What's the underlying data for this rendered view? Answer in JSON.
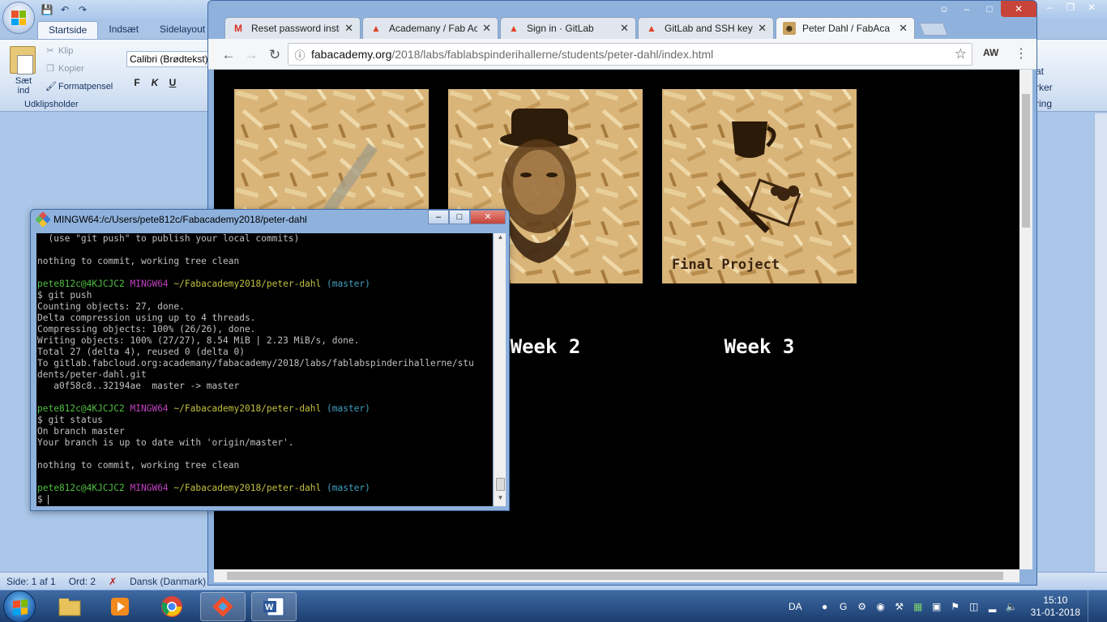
{
  "word": {
    "tabs": [
      "Startside",
      "Indsæt",
      "Sidelayout"
    ],
    "clipboard": {
      "paste_label": "Sæt ind",
      "cut": "Klip",
      "copy": "Kopier",
      "format_painter": "Formatpensel",
      "group_label": "Udklipsholder"
    },
    "font_name": "Calibri (Brødtekst)",
    "format_buttons": [
      "F",
      "K",
      "U"
    ],
    "right_fragments": [
      "at",
      "rker",
      "ring"
    ],
    "status": {
      "page": "Side: 1 af 1",
      "words": "Ord: 2",
      "language": "Dansk (Danmark)"
    }
  },
  "chrome": {
    "tabs": [
      {
        "title": "Reset password instr",
        "favicon": "gmail-icon"
      },
      {
        "title": "Academany / Fab Ac",
        "favicon": "gitlab-icon"
      },
      {
        "title": "Sign in · GitLab",
        "favicon": "gitlab-icon"
      },
      {
        "title": "GitLab and SSH keys",
        "favicon": "gitlab-icon"
      },
      {
        "title": "Peter Dahl / FabAca",
        "favicon": "avatar-icon"
      }
    ],
    "active_tab": 4,
    "url_domain": "fabacademy.org",
    "url_path": "/2018/labs/fablabspinderihallerne/students/peter-dahl/index.html",
    "extension_label": "AW"
  },
  "page": {
    "cards": [
      {
        "label": "",
        "image": "osb-board-plain"
      },
      {
        "label": "Week 2",
        "image": "osb-board-portrait"
      },
      {
        "label": "Week 3",
        "image": "osb-board-final-project"
      }
    ],
    "card_caption": "Final Project"
  },
  "terminal": {
    "title": "MINGW64:/c/Users/pete812c/Fabacademy2018/peter-dahl",
    "lines": [
      {
        "parts": [
          {
            "t": "  (use \"git push\" to publish your local commits)",
            "c": ""
          }
        ]
      },
      {
        "parts": [
          {
            "t": "",
            "c": ""
          }
        ]
      },
      {
        "parts": [
          {
            "t": "nothing to commit, working tree clean",
            "c": ""
          }
        ]
      },
      {
        "parts": [
          {
            "t": "",
            "c": ""
          }
        ]
      },
      {
        "parts": [
          {
            "t": "pete812c@4KJCJC2 ",
            "c": "g"
          },
          {
            "t": "MINGW64 ",
            "c": "m"
          },
          {
            "t": "~/Fabacademy2018/peter-dahl ",
            "c": "y"
          },
          {
            "t": "(master)",
            "c": "c"
          }
        ]
      },
      {
        "parts": [
          {
            "t": "$ git push",
            "c": ""
          }
        ]
      },
      {
        "parts": [
          {
            "t": "Counting objects: 27, done.",
            "c": ""
          }
        ]
      },
      {
        "parts": [
          {
            "t": "Delta compression using up to 4 threads.",
            "c": ""
          }
        ]
      },
      {
        "parts": [
          {
            "t": "Compressing objects: 100% (26/26), done.",
            "c": ""
          }
        ]
      },
      {
        "parts": [
          {
            "t": "Writing objects: 100% (27/27), 8.54 MiB | 2.23 MiB/s, done.",
            "c": ""
          }
        ]
      },
      {
        "parts": [
          {
            "t": "Total 27 (delta 4), reused 0 (delta 0)",
            "c": ""
          }
        ]
      },
      {
        "parts": [
          {
            "t": "To gitlab.fabcloud.org:academany/fabacademy/2018/labs/fablabspinderihallerne/stu",
            "c": ""
          }
        ]
      },
      {
        "parts": [
          {
            "t": "dents/peter-dahl.git",
            "c": ""
          }
        ]
      },
      {
        "parts": [
          {
            "t": "   a0f58c8..32194ae  master -> master",
            "c": ""
          }
        ]
      },
      {
        "parts": [
          {
            "t": "",
            "c": ""
          }
        ]
      },
      {
        "parts": [
          {
            "t": "pete812c@4KJCJC2 ",
            "c": "g"
          },
          {
            "t": "MINGW64 ",
            "c": "m"
          },
          {
            "t": "~/Fabacademy2018/peter-dahl ",
            "c": "y"
          },
          {
            "t": "(master)",
            "c": "c"
          }
        ]
      },
      {
        "parts": [
          {
            "t": "$ git status",
            "c": ""
          }
        ]
      },
      {
        "parts": [
          {
            "t": "On branch master",
            "c": ""
          }
        ]
      },
      {
        "parts": [
          {
            "t": "Your branch is up to date with 'origin/master'.",
            "c": ""
          }
        ]
      },
      {
        "parts": [
          {
            "t": "",
            "c": ""
          }
        ]
      },
      {
        "parts": [
          {
            "t": "nothing to commit, working tree clean",
            "c": ""
          }
        ]
      },
      {
        "parts": [
          {
            "t": "",
            "c": ""
          }
        ]
      },
      {
        "parts": [
          {
            "t": "pete812c@4KJCJC2 ",
            "c": "g"
          },
          {
            "t": "MINGW64 ",
            "c": "m"
          },
          {
            "t": "~/Fabacademy2018/peter-dahl ",
            "c": "y"
          },
          {
            "t": "(master)",
            "c": "c"
          }
        ]
      },
      {
        "parts": [
          {
            "t": "$ ",
            "c": ""
          }
        ],
        "cursor": true
      }
    ]
  },
  "taskbar": {
    "apps": [
      "explorer-icon",
      "media-player-icon",
      "chrome-icon",
      "git-bash-icon",
      "word-icon"
    ],
    "active_app": 3,
    "language": "DA",
    "time": "15:10",
    "date": "31-01-2018"
  }
}
